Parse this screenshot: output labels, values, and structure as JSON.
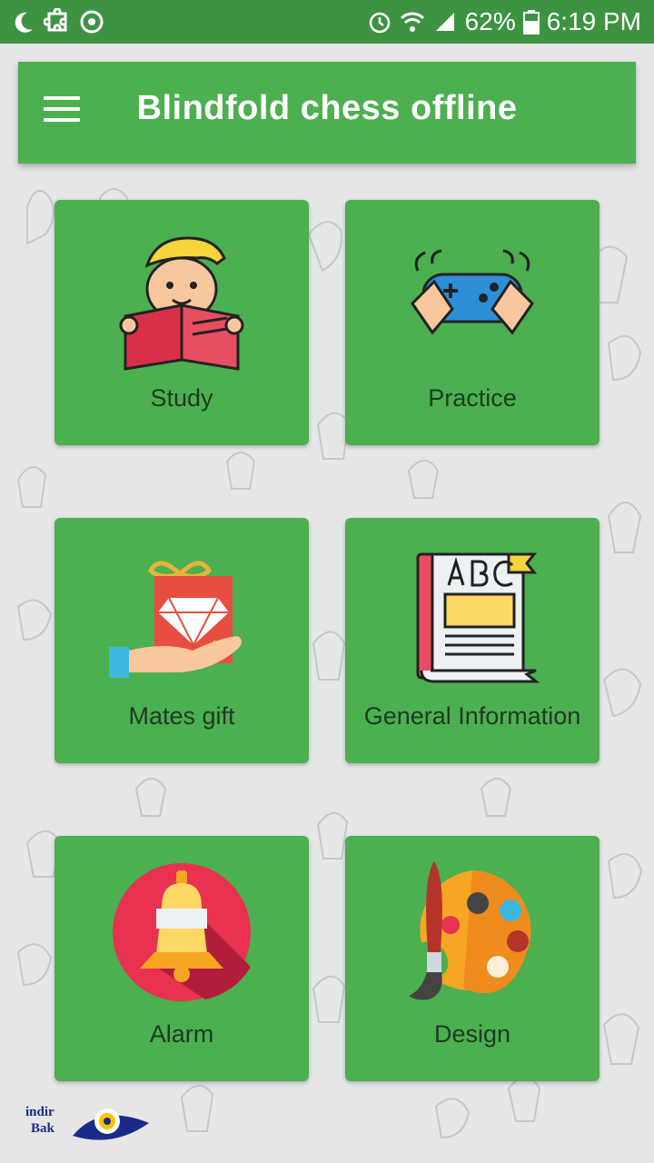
{
  "status_bar": {
    "battery": "62%",
    "time": "6:19 PM",
    "icons": [
      "moon-icon",
      "puzzle-icon",
      "sync-icon",
      "alarm-icon",
      "wifi-icon",
      "signal-icon",
      "battery-icon"
    ]
  },
  "app_bar": {
    "title": "Blindfold chess offline",
    "menu_icon": "hamburger-menu-icon"
  },
  "tiles": [
    {
      "label": "Study",
      "icon": "reading-boy-icon"
    },
    {
      "label": "Practice",
      "icon": "game-controller-icon"
    },
    {
      "label": "Mates gift",
      "icon": "gift-diamond-hand-icon"
    },
    {
      "label": "General Information",
      "icon": "abc-book-icon"
    },
    {
      "label": "Alarm",
      "icon": "bell-icon"
    },
    {
      "label": "Design",
      "icon": "paint-palette-icon"
    }
  ],
  "watermark": {
    "line1": "indir",
    "line2": "Bak"
  },
  "colors": {
    "status_bar": "#3e9342",
    "app_bar": "#4caf50",
    "tile": "#4caf50",
    "background": "#e6e6e6",
    "label_text": "#1e3a1f"
  }
}
